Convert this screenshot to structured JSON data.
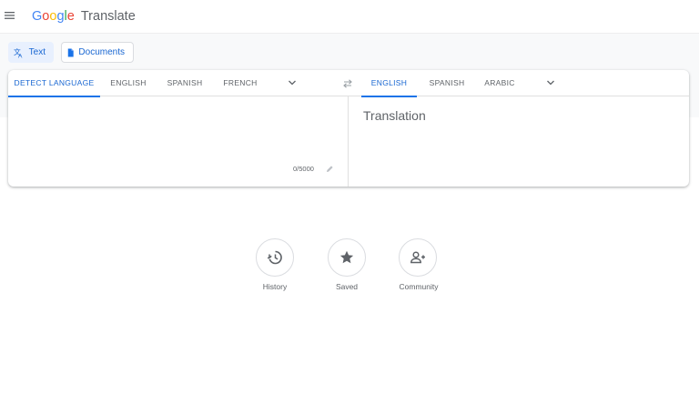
{
  "header": {
    "logo_letters": [
      "G",
      "o",
      "o",
      "g",
      "l",
      "e"
    ],
    "product": "Translate"
  },
  "modes": [
    {
      "label": "Text",
      "icon": "translate-icon",
      "active": true
    },
    {
      "label": "Documents",
      "icon": "document-icon",
      "active": false
    }
  ],
  "source_langs": [
    {
      "label": "DETECT LANGUAGE",
      "active": true
    },
    {
      "label": "ENGLISH",
      "active": false
    },
    {
      "label": "SPANISH",
      "active": false
    },
    {
      "label": "FRENCH",
      "active": false
    }
  ],
  "target_langs": [
    {
      "label": "ENGLISH",
      "active": true
    },
    {
      "label": "SPANISH",
      "active": false
    },
    {
      "label": "ARABIC",
      "active": false
    }
  ],
  "source": {
    "value": "",
    "counter": "0/5000"
  },
  "target": {
    "placeholder": "Translation"
  },
  "actions": [
    {
      "label": "History",
      "icon": "history-icon"
    },
    {
      "label": "Saved",
      "icon": "star-icon"
    },
    {
      "label": "Community",
      "icon": "community-icon"
    }
  ],
  "colors": {
    "accent": "#1a73e8",
    "accent_text": "#1967d2",
    "muted": "#5f6368"
  }
}
